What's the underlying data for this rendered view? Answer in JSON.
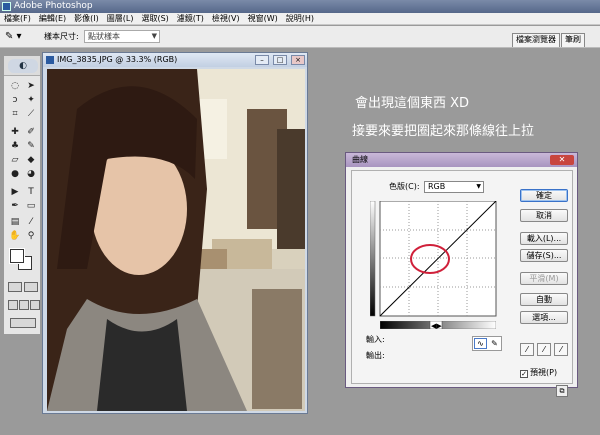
{
  "app": {
    "title": "Adobe Photoshop"
  },
  "menu": [
    "檔案(F)",
    "編輯(E)",
    "影像(I)",
    "圖層(L)",
    "選取(S)",
    "濾鏡(T)",
    "檢視(V)",
    "視窗(W)",
    "說明(H)"
  ],
  "options_bar": {
    "sample_label": "樣本尺寸:",
    "sample_value": "點狀樣本"
  },
  "palette_tabs": [
    "檔案瀏覽器",
    "筆刷"
  ],
  "document": {
    "title": "IMG_3835.JPG @ 33.3% (RGB)"
  },
  "annotation": {
    "line1": "會出現這個東西 XD",
    "line2": "接要來要把圈起來那條線往上拉"
  },
  "curves_dialog": {
    "title": "曲線",
    "channel_label": "色版(C):",
    "channel_value": "RGB",
    "buttons": [
      "確定",
      "取消",
      "載入(L)...",
      "儲存(S)...",
      "平滑(M)",
      "自動",
      "選項..."
    ],
    "input_label": "輸入:",
    "output_label": "輸出:",
    "preview_label": "預視(P)",
    "preview_checked": true
  },
  "colors": {
    "highlight_circle": "#d0203a",
    "dialog_title": "#a894c0"
  },
  "icons": {
    "tools": [
      "marquee-icon",
      "move-icon",
      "lasso-icon",
      "magic-wand-icon",
      "crop-icon",
      "slice-icon",
      "healing-icon",
      "brush-icon",
      "stamp-icon",
      "history-brush-icon",
      "eraser-icon",
      "bucket-icon",
      "blur-icon",
      "dodge-icon",
      "path-select-icon",
      "type-icon",
      "pen-icon",
      "shape-icon",
      "notes-icon",
      "eyedropper-icon",
      "hand-icon",
      "zoom-icon"
    ]
  }
}
